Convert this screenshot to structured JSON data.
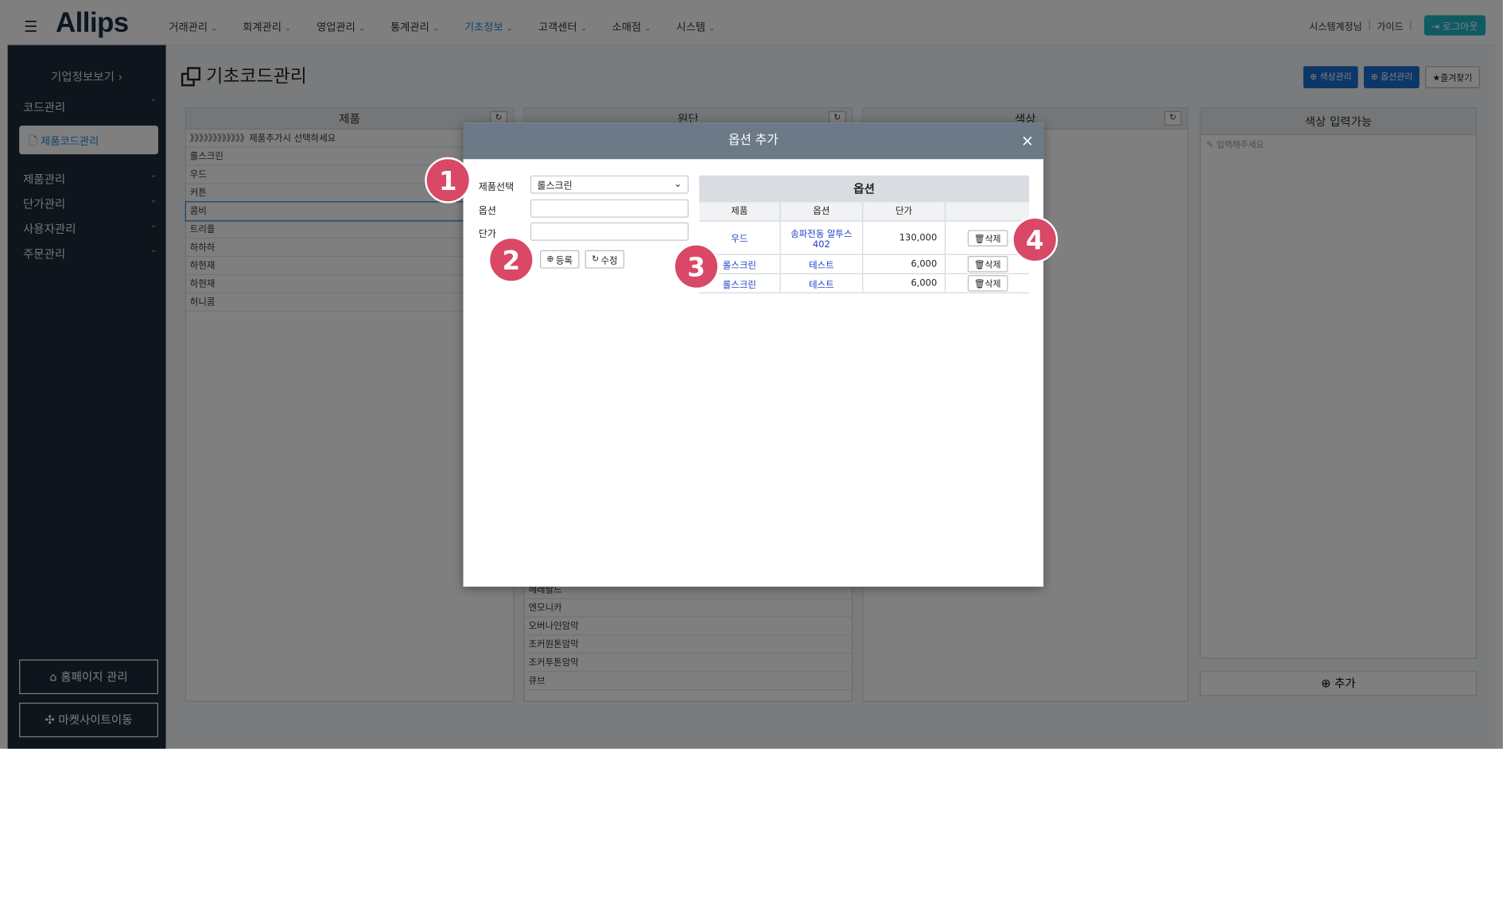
{
  "app": {
    "logo": "Allips",
    "hamburger_icon": "menu-icon"
  },
  "topnav": {
    "items": [
      {
        "label": "거래관리"
      },
      {
        "label": "회계관리"
      },
      {
        "label": "영업관리"
      },
      {
        "label": "통계관리"
      },
      {
        "label": "기초정보"
      },
      {
        "label": "고객센터"
      },
      {
        "label": "소매점"
      },
      {
        "label": "시스템"
      }
    ],
    "active_index": 4,
    "user": "시스템계정님",
    "sep": "|",
    "guide": "가이드",
    "logout": "로그아웃",
    "logout_icon": "logout-icon"
  },
  "sidebar": {
    "company": "기업정보보기 ›",
    "group_code": "코드관리",
    "active_item": "제품코드관리",
    "groups": [
      {
        "label": "제품관리"
      },
      {
        "label": "단가관리"
      },
      {
        "label": "사용자관리"
      },
      {
        "label": "주문관리"
      }
    ],
    "home_btn": "홈페이지 관리",
    "market_btn": "마켓사이트이동"
  },
  "page": {
    "title": "기초코드관리",
    "btn_color": "색상관리",
    "btn_option": "옵션관리",
    "btn_fav": "즐겨찾기"
  },
  "panels": {
    "product": {
      "header": "제품",
      "rows": [
        "》》》》》》》》》》》》제품추가시 선택하세요",
        "롤스크린",
        "우드",
        "커튼",
        "콤비",
        "트리플",
        "하하하",
        "하현재",
        "하현재",
        "허니콤"
      ]
    },
    "fabric": {
      "header": "원단",
      "rows": [
        "헤레랄드",
        "엔모니카",
        "오버나인암막",
        "조커원톤암막",
        "조커투톤암막",
        "큐브"
      ]
    },
    "color": {
      "header": "색상"
    },
    "color_input": {
      "header": "색상 입력가능",
      "placeholder": "✎ 입력해주세요"
    },
    "add_button": "추가"
  },
  "modal": {
    "title": "옵션 추가",
    "close": "×",
    "label_product": "제품선택",
    "label_option": "옵션",
    "label_price": "단가",
    "product_value": "롤스크린",
    "option_value": "",
    "price_value": "",
    "btn_register": "등록",
    "btn_edit": "수정",
    "table_title": "옵션",
    "columns": [
      "제품",
      "옵션",
      "단가",
      ""
    ],
    "rows": [
      {
        "product": "우드",
        "option": "송파전동 알투스 402",
        "price": "130,000",
        "action": "삭제"
      },
      {
        "product": "롤스크린",
        "option": "테스트",
        "price": "6,000",
        "action": "삭제"
      },
      {
        "product": "롤스크린",
        "option": "테스트",
        "price": "6,000",
        "action": "삭제"
      }
    ]
  },
  "markers": [
    "1",
    "2",
    "3",
    "4"
  ],
  "colors": {
    "marker": "#d94866",
    "modal_header": "#6c7a87",
    "sidebar": "#1d2b3a",
    "primary": "#1a6fd1"
  }
}
